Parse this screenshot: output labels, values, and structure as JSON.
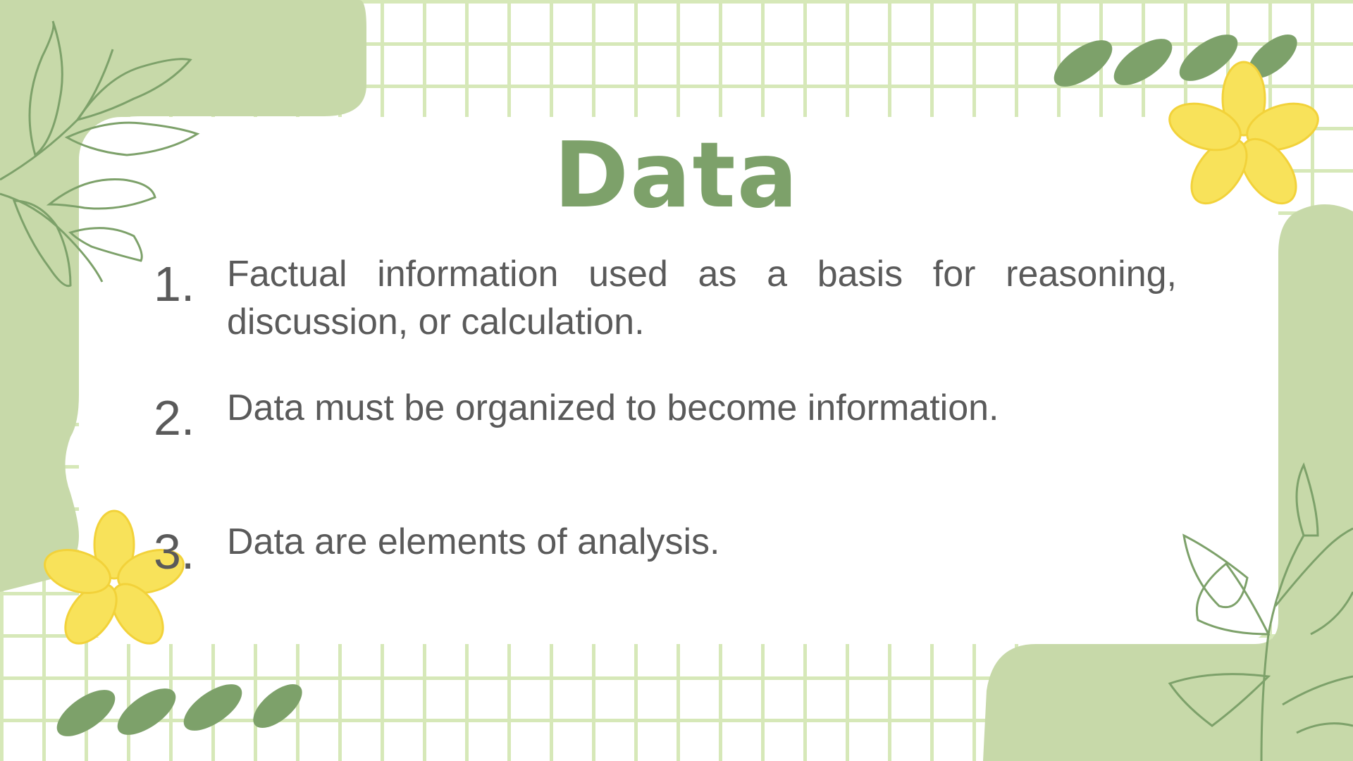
{
  "slide": {
    "title": "Data",
    "items": [
      {
        "number": "1.",
        "text": "Factual information used as a basis for reasoning, discussion, or calculation."
      },
      {
        "number": "2.",
        "text": "Data must be organized to become information."
      },
      {
        "number": "3.",
        "text": "Data are elements of analysis."
      }
    ]
  },
  "colors": {
    "title": "#7da16a",
    "body_text": "#5a5a5a",
    "grid": "#d6e8b8",
    "blob": "#c7d9a9",
    "leaf": "#7da16a",
    "flower": "#f8e25a"
  },
  "decorations": [
    "leaf-sprig-icon",
    "flower-icon",
    "leaf-stroke-icon",
    "background-grid",
    "green-blob"
  ]
}
